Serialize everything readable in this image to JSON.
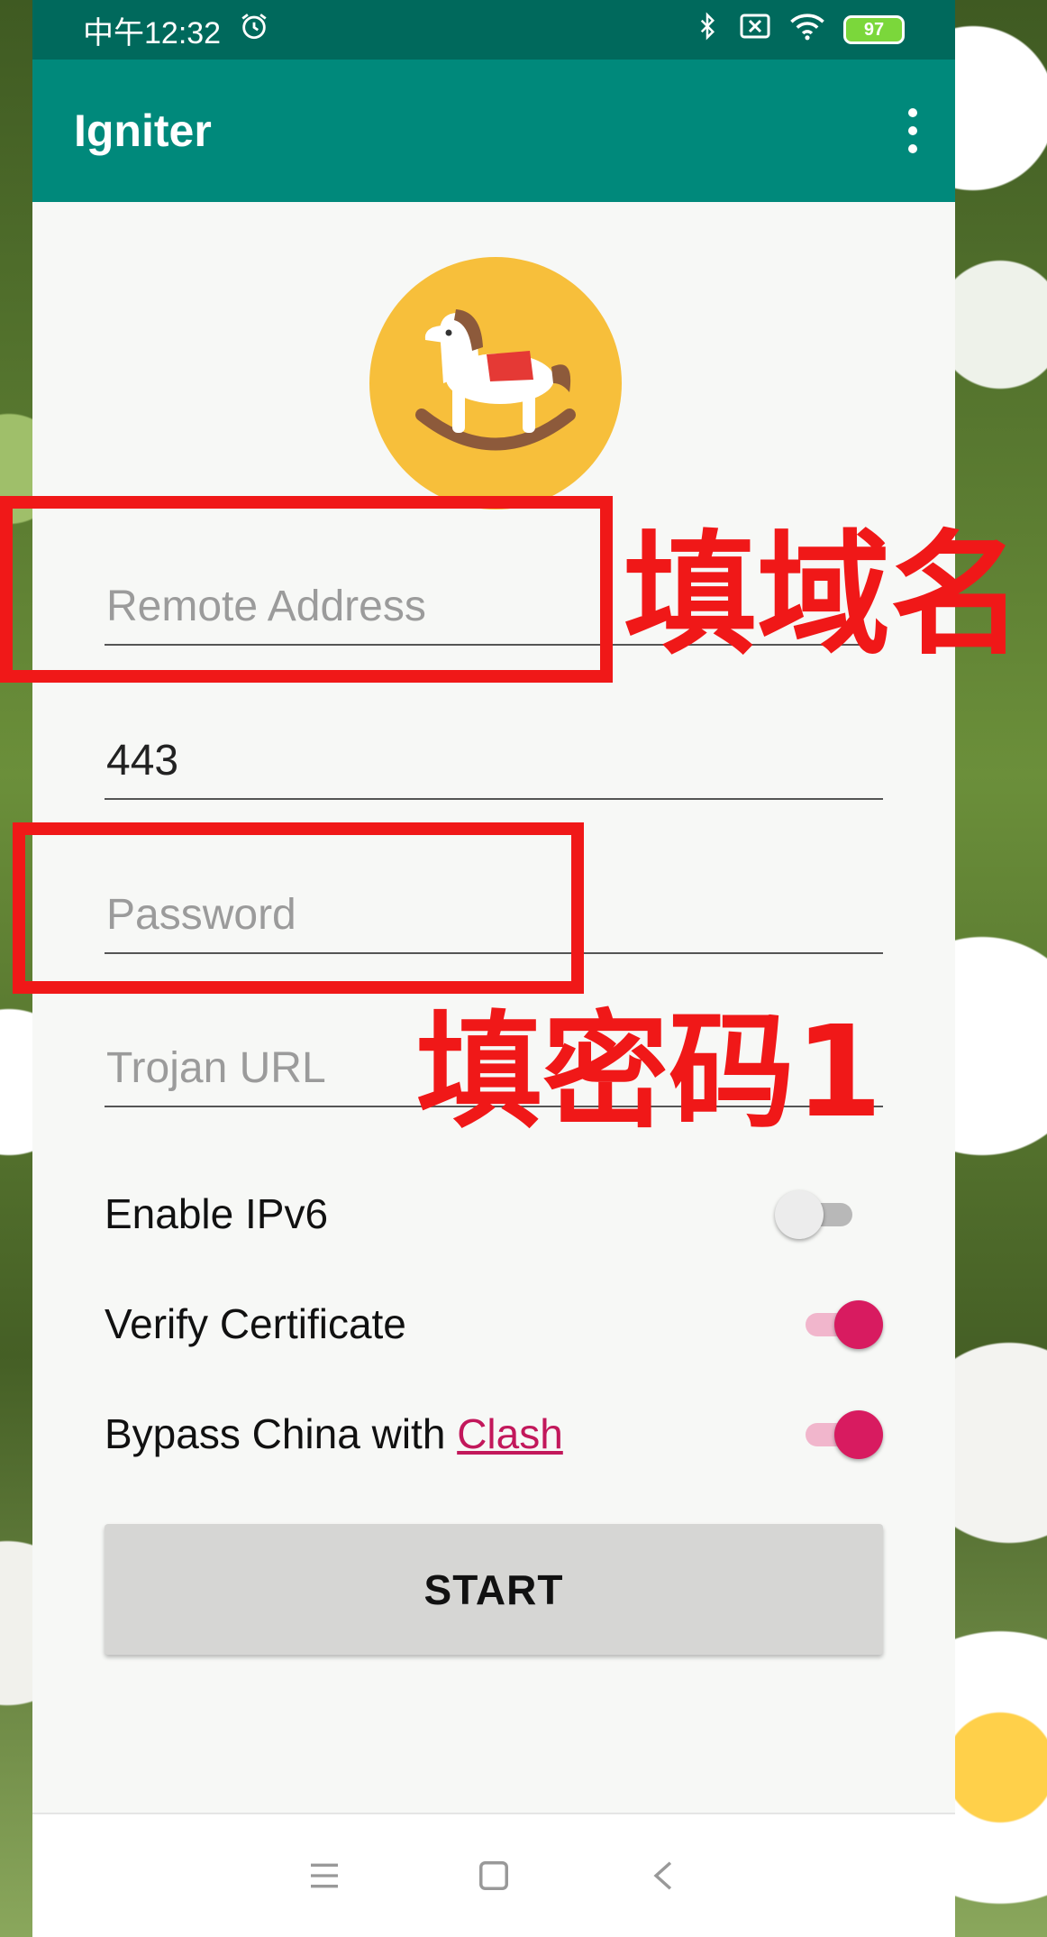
{
  "statusbar": {
    "time": "中午12:32",
    "battery": "97",
    "icons": [
      "alarm-icon",
      "bluetooth-icon",
      "sim-icon",
      "wifi-icon",
      "battery-icon"
    ]
  },
  "appbar": {
    "title": "Igniter",
    "menu_icon": "more-vert-icon"
  },
  "logo": {
    "icon": "rocking-horse-icon",
    "color": "#f7bf3b"
  },
  "form": {
    "remote_address": {
      "placeholder": "Remote Address",
      "value": ""
    },
    "port": {
      "placeholder": "",
      "value": "443"
    },
    "password": {
      "placeholder": "Password",
      "value": ""
    },
    "trojan_url": {
      "placeholder": "Trojan URL",
      "value": ""
    }
  },
  "switches": {
    "ipv6": {
      "label": "Enable IPv6",
      "checked": false
    },
    "verify_cert": {
      "label": "Verify Certificate",
      "checked": true
    },
    "bypass_china": {
      "label_prefix": "Bypass China with ",
      "link_text": "Clash",
      "checked": true
    }
  },
  "start_button": {
    "label": "START"
  },
  "navbar": {
    "icons": [
      "menu-icon",
      "home-icon",
      "back-icon"
    ]
  },
  "annotations": {
    "domain_note": "填域名",
    "password_note": "填密码1"
  },
  "colors": {
    "statusbar": "#00695c",
    "appbar": "#00897b",
    "accent": "#d81b60",
    "annotation": "#f01818"
  }
}
